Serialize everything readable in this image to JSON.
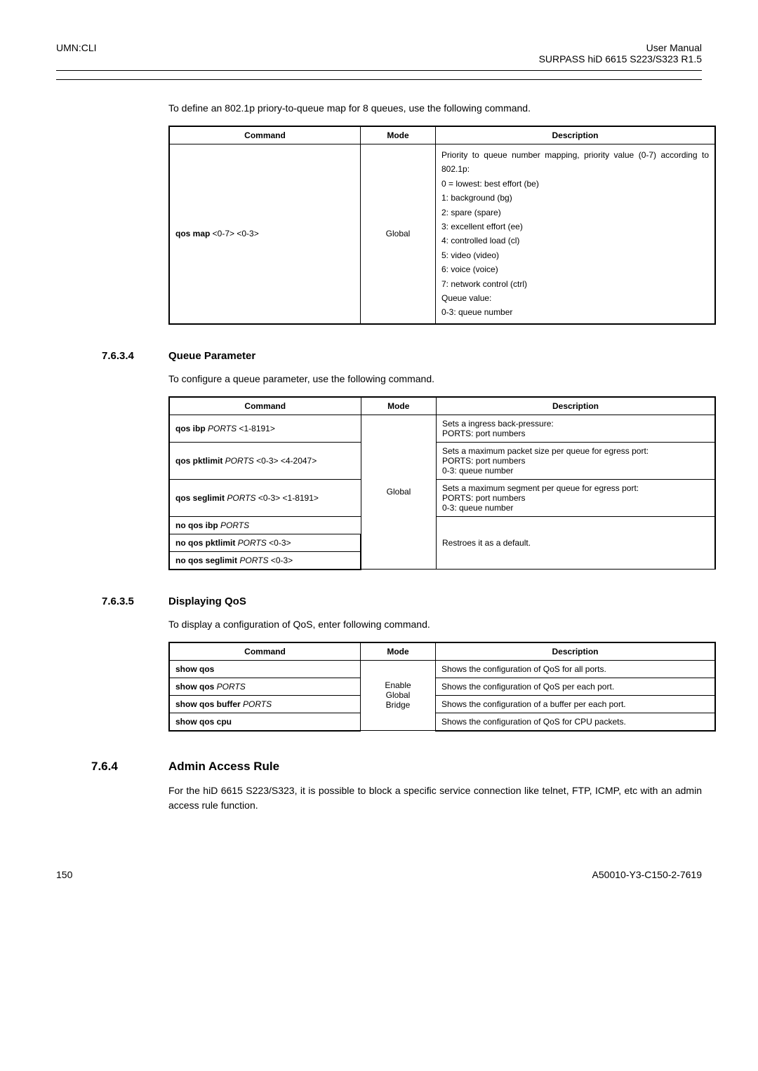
{
  "header": {
    "left": "UMN:CLI",
    "right_top": "User Manual",
    "right_sub": "SURPASS hiD 6615 S223/S323 R1.5"
  },
  "intro_map": "To define an 802.1p priory-to-queue map for 8 queues, use the following command.",
  "tableHeaders": {
    "command": "Command",
    "mode": "Mode",
    "description": "Description"
  },
  "mapTable": {
    "cmd_bold": "qos map",
    "cmd_args": " <0-7> <0-3>",
    "mode": "Global",
    "desc_lines": [
      "Priority to queue number mapping, priority value (0-7) according to 802.1p:",
      "0 = lowest: best effort (be)",
      "1: background (bg)",
      "2: spare (spare)",
      "3: excellent effort (ee)",
      "4: controlled load (cl)",
      "5: video (video)",
      "6: voice (voice)",
      "7: network control (ctrl)",
      "Queue value:",
      "0-3: queue number"
    ]
  },
  "sec_queue": {
    "num": "7.6.3.4",
    "title": "Queue Parameter",
    "intro": "To configure a queue parameter, use the following command."
  },
  "queueTable": {
    "mode": "Global",
    "r1_cmd_b": "qos ibp",
    "r1_cmd_i": " PORTS",
    "r1_cmd_e": " <1-8191>",
    "r1_desc": [
      "Sets a ingress back-pressure:",
      "PORTS: port numbers"
    ],
    "r2_cmd_b": "qos pktlimit",
    "r2_cmd_i": " PORTS",
    "r2_cmd_e": " <0-3> <4-2047>",
    "r2_desc": [
      "Sets a maximum packet size per queue for egress port:",
      "PORTS: port numbers",
      "0-3: queue number"
    ],
    "r3_cmd_b": "qos seglimit",
    "r3_cmd_i": " PORTS",
    "r3_cmd_e": " <0-3> <1-8191>",
    "r3_desc": [
      "Sets a maximum segment per queue for egress port:",
      "PORTS: port numbers",
      "0-3: queue number"
    ],
    "r4_cmd_b": "no qos ibp",
    "r4_cmd_i": " PORTS",
    "r5_cmd_b": "no qos pktlimit",
    "r5_cmd_i": " PORTS",
    "r5_cmd_e": " <0-3>",
    "r6_cmd_b": "no qos seglimit",
    "r6_cmd_i": " PORTS",
    "r6_cmd_e": " <0-3>",
    "r456_desc": "Restroes it as a default."
  },
  "sec_display": {
    "num": "7.6.3.5",
    "title": "Displaying QoS",
    "intro": "To display a configuration of QoS, enter following command."
  },
  "displayTable": {
    "mode_lines": [
      "Enable",
      "Global",
      "Bridge"
    ],
    "r1_cmd_b": "show qos",
    "r1_desc": "Shows the configuration of QoS for all ports.",
    "r2_cmd_b": "show qos",
    "r2_cmd_i": " PORTS",
    "r2_desc": "Shows the configuration of QoS per each port.",
    "r3_cmd_b": "show qos buffer",
    "r3_cmd_i": " PORTS",
    "r3_desc": "Shows the configuration of a buffer per each port.",
    "r4_cmd_b": "show qos cpu",
    "r4_desc": "Shows the configuration of QoS for CPU packets."
  },
  "sec_admin": {
    "num": "7.6.4",
    "title": "Admin Access Rule",
    "para": "For the hiD 6615 S223/S323, it is possible to block a specific service connection like telnet, FTP, ICMP, etc with an admin access rule function."
  },
  "footer": {
    "page": "150",
    "doc": "A50010-Y3-C150-2-7619"
  },
  "chart_data": {
    "type": "table",
    "tables": [
      {
        "title": "qos map command",
        "columns": [
          "Command",
          "Mode",
          "Description"
        ],
        "rows": [
          [
            "qos map <0-7> <0-3>",
            "Global",
            "Priority to queue number mapping, priority value (0-7) according to 802.1p: 0 = lowest: best effort (be); 1: background (bg); 2: spare (spare); 3: excellent effort (ee); 4: controlled load (cl); 5: video (video); 6: voice (voice); 7: network control (ctrl); Queue value: 0-3: queue number"
          ]
        ]
      },
      {
        "title": "Queue Parameter commands",
        "columns": [
          "Command",
          "Mode",
          "Description"
        ],
        "rows": [
          [
            "qos ibp PORTS <1-8191>",
            "Global",
            "Sets a ingress back-pressure: PORTS: port numbers"
          ],
          [
            "qos pktlimit PORTS <0-3> <4-2047>",
            "Global",
            "Sets a maximum packet size per queue for egress port: PORTS: port numbers; 0-3: queue number"
          ],
          [
            "qos seglimit PORTS <0-3> <1-8191>",
            "Global",
            "Sets a maximum segment per queue for egress port: PORTS: port numbers; 0-3: queue number"
          ],
          [
            "no qos ibp PORTS",
            "Global",
            "Restroes it as a default."
          ],
          [
            "no qos pktlimit PORTS <0-3>",
            "Global",
            "Restroes it as a default."
          ],
          [
            "no qos seglimit PORTS <0-3>",
            "Global",
            "Restroes it as a default."
          ]
        ]
      },
      {
        "title": "Displaying QoS commands",
        "columns": [
          "Command",
          "Mode",
          "Description"
        ],
        "rows": [
          [
            "show qos",
            "Enable / Global / Bridge",
            "Shows the configuration of QoS for all ports."
          ],
          [
            "show qos PORTS",
            "Enable / Global / Bridge",
            "Shows the configuration of QoS per each port."
          ],
          [
            "show qos buffer PORTS",
            "Enable / Global / Bridge",
            "Shows the configuration of a buffer per each port."
          ],
          [
            "show qos cpu",
            "Enable / Global / Bridge",
            "Shows the configuration of QoS for CPU packets."
          ]
        ]
      }
    ]
  }
}
